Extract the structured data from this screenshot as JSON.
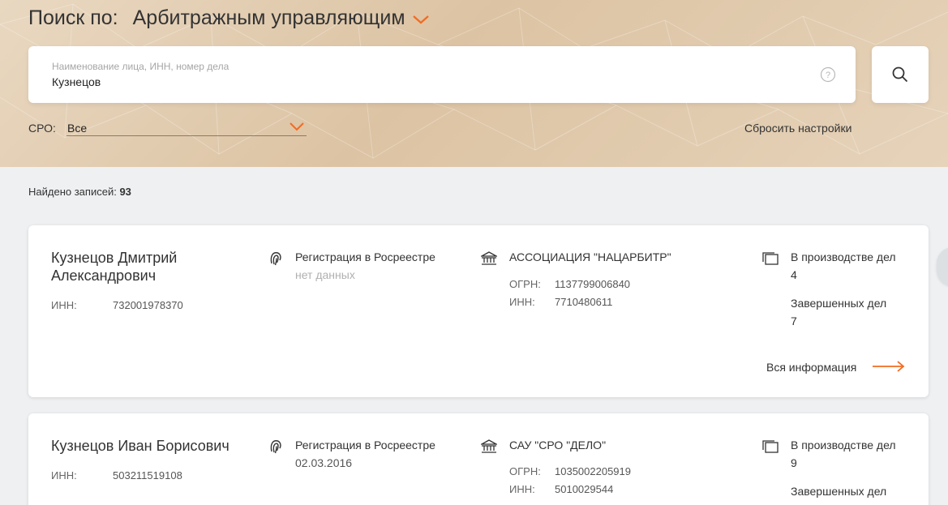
{
  "header": {
    "search_prefix": "Поиск по:",
    "search_mode": "Арбитражным управляющим"
  },
  "search": {
    "placeholder": "Наименование лица, ИНН, номер дела",
    "value": "Кузнецов",
    "help_symbol": "?"
  },
  "filters": {
    "sro_label": "СРО:",
    "sro_value": "Все",
    "reset_label": "Сбросить настройки"
  },
  "results": {
    "found_label": "Найдено записей:",
    "found_count": "93"
  },
  "labels": {
    "inn": "ИНН:",
    "ogrn": "ОГРН:",
    "registration": "Регистрация в Росреестре",
    "in_progress": "В производстве дел",
    "completed": "Завершенных дел",
    "more_info": "Вся информация"
  },
  "cards": [
    {
      "name": "Кузнецов Дмитрий Александрович",
      "inn": "732001978370",
      "registration": "нет данных",
      "org_name": "АССОЦИАЦИЯ \"НАЦАРБИТР\"",
      "org_ogrn": "1137799006840",
      "org_inn": "7710480611",
      "cases_in_progress": "4",
      "cases_completed": "7"
    },
    {
      "name": "Кузнецов Иван Борисович",
      "inn": "503211519108",
      "registration": "02.03.2016",
      "org_name": "САУ \"СРО \"ДЕЛО\"",
      "org_ogrn": "1035002205919",
      "org_inn": "5010029544",
      "cases_in_progress": "9"
    }
  ],
  "icons": {
    "mode_dropdown": "chevron-down-icon",
    "help": "help-circle-icon",
    "search": "search-icon",
    "sro_dropdown": "chevron-down-icon",
    "registration": "fingerprint-icon",
    "organization": "bank-building-icon",
    "cases": "folders-icon",
    "more": "arrow-right-icon"
  },
  "colors": {
    "accent": "#f26b21",
    "muted": "#b0b0b0",
    "text": "#333333"
  }
}
